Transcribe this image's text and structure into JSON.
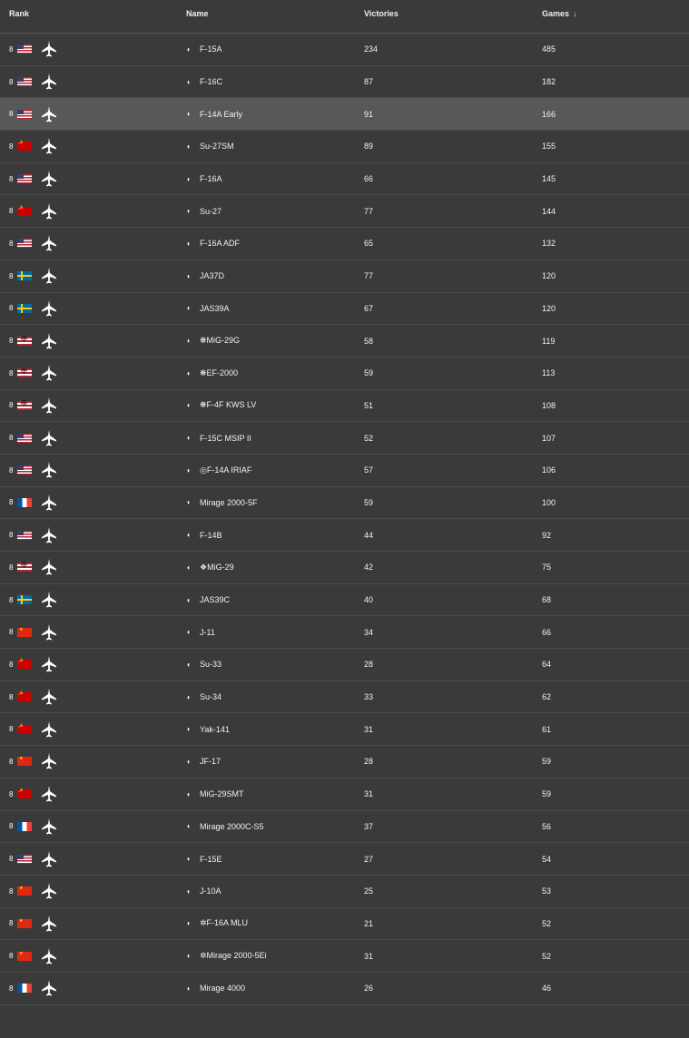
{
  "header": {
    "rank": "Rank",
    "name": "Name",
    "victories": "Victories",
    "games": "Games",
    "sort_icon": "arrow-down-icon"
  },
  "rows": [
    {
      "rank": "8",
      "flag": "us",
      "name": "F-15A",
      "victories": "234",
      "games": "485"
    },
    {
      "rank": "8",
      "flag": "us",
      "name": "F-16C",
      "victories": "87",
      "games": "182"
    },
    {
      "rank": "8",
      "flag": "us",
      "name": "F-14A Early",
      "victories": "91",
      "games": "166"
    },
    {
      "rank": "8",
      "flag": "ussr",
      "name": "Su-27SM",
      "victories": "89",
      "games": "155"
    },
    {
      "rank": "8",
      "flag": "us",
      "name": "F-16A",
      "victories": "66",
      "games": "145"
    },
    {
      "rank": "8",
      "flag": "ussr",
      "name": "Su-27",
      "victories": "77",
      "games": "144"
    },
    {
      "rank": "8",
      "flag": "us",
      "name": "F-16A ADF",
      "victories": "65",
      "games": "132"
    },
    {
      "rank": "8",
      "flag": "se",
      "name": "JA37D",
      "victories": "77",
      "games": "120"
    },
    {
      "rank": "8",
      "flag": "se",
      "name": "JAS39A",
      "victories": "67",
      "games": "120"
    },
    {
      "rank": "8",
      "flag": "de",
      "name": "❋MiG-29G",
      "victories": "58",
      "games": "119"
    },
    {
      "rank": "8",
      "flag": "de",
      "name": "❋EF-2000",
      "victories": "59",
      "games": "113"
    },
    {
      "rank": "8",
      "flag": "de",
      "name": "❋F-4F KWS LV",
      "victories": "51",
      "games": "108"
    },
    {
      "rank": "8",
      "flag": "us",
      "name": "F-15C MSIP II",
      "victories": "52",
      "games": "107"
    },
    {
      "rank": "8",
      "flag": "us",
      "name": "◎F-14A IRIAF",
      "victories": "57",
      "games": "106"
    },
    {
      "rank": "8",
      "flag": "fr",
      "name": "Mirage 2000-5F",
      "victories": "59",
      "games": "100"
    },
    {
      "rank": "8",
      "flag": "us",
      "name": "F-14B",
      "victories": "44",
      "games": "92"
    },
    {
      "rank": "8",
      "flag": "de",
      "name": "❖MiG-29",
      "victories": "42",
      "games": "75"
    },
    {
      "rank": "8",
      "flag": "se",
      "name": "JAS39C",
      "victories": "40",
      "games": "68"
    },
    {
      "rank": "8",
      "flag": "cn",
      "name": "J-11",
      "victories": "34",
      "games": "66"
    },
    {
      "rank": "8",
      "flag": "ussr",
      "name": "Su-33",
      "victories": "28",
      "games": "64"
    },
    {
      "rank": "8",
      "flag": "ussr",
      "name": "Su-34",
      "victories": "33",
      "games": "62"
    },
    {
      "rank": "8",
      "flag": "ussr",
      "name": "Yak-141",
      "victories": "31",
      "games": "61"
    },
    {
      "rank": "8",
      "flag": "cn",
      "name": "JF-17",
      "victories": "28",
      "games": "59"
    },
    {
      "rank": "8",
      "flag": "ussr",
      "name": "MiG-29SMT",
      "victories": "31",
      "games": "59"
    },
    {
      "rank": "8",
      "flag": "fr",
      "name": "Mirage 2000C-S5",
      "victories": "37",
      "games": "56"
    },
    {
      "rank": "8",
      "flag": "us",
      "name": "F-15E",
      "victories": "27",
      "games": "54"
    },
    {
      "rank": "8",
      "flag": "cn",
      "name": "J-10A",
      "victories": "25",
      "games": "53"
    },
    {
      "rank": "8",
      "flag": "cn",
      "name": "✲F-16A MLU",
      "victories": "21",
      "games": "52"
    },
    {
      "rank": "8",
      "flag": "cn",
      "name": "✲Mirage 2000-5Ei",
      "victories": "31",
      "games": "52"
    },
    {
      "rank": "8",
      "flag": "fr",
      "name": "Mirage 4000",
      "victories": "26",
      "games": "46"
    }
  ]
}
